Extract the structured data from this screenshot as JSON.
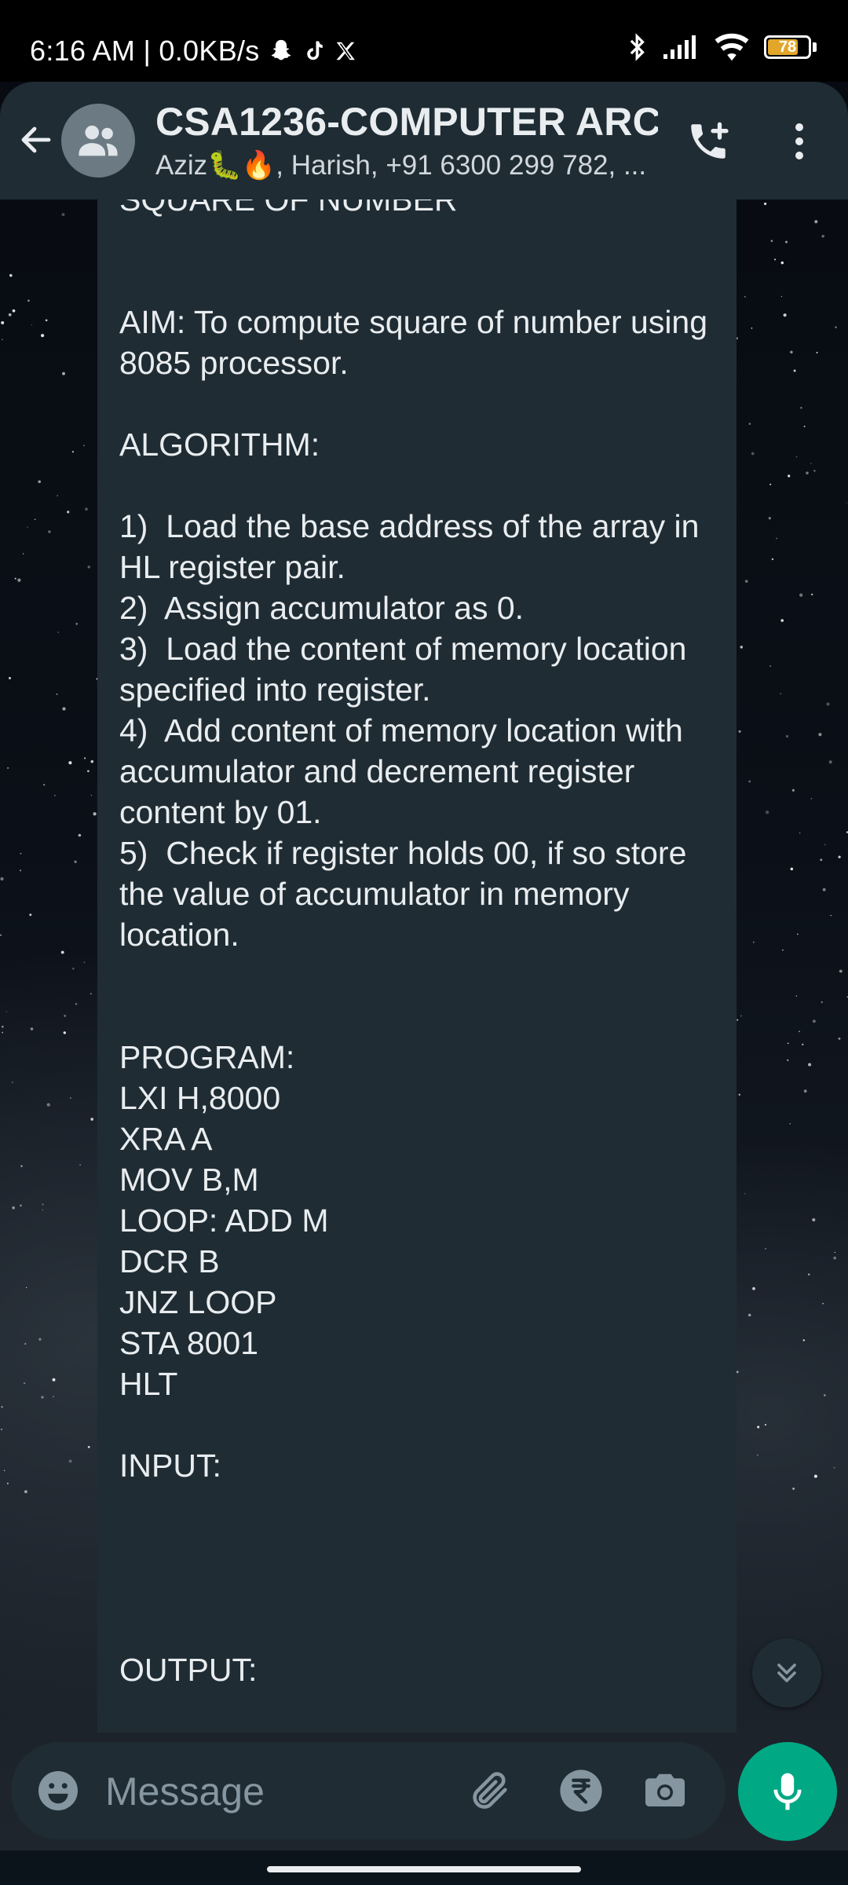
{
  "status_bar": {
    "time_and_speed": "6:16 AM | 0.0KB/s",
    "battery_level": "78",
    "icons": [
      "snapchat-icon",
      "tiktok-icon",
      "x-icon",
      "bluetooth-icon",
      "signal-icon",
      "wifi-icon",
      "battery-icon"
    ]
  },
  "header": {
    "title": "CSA1236-COMPUTER ARC...",
    "subtitle": "Aziz🐛🔥, Harish, +91 6300 299 782, ...",
    "icons": [
      "back-arrow-icon",
      "group-avatar-icon",
      "add-call-icon",
      "more-vert-icon"
    ]
  },
  "message": {
    "text": "SQUARE OF NUMBER\n\n\nAIM: To compute square of number using 8085 processor.\n\nALGORITHM:\n\n1)  Load the base address of the array in HL register pair.\n2)  Assign accumulator as 0.\n3)  Load the content of memory location specified into register.\n4)  Add content of memory location with accumulator and decrement register content by 01.\n5)  Check if register holds 00, if so store the value of accumulator in memory location.\n\n\nPROGRAM:\nLXI H,8000\nXRA A\nMOV B,M\nLOOP: ADD M\nDCR B\nJNZ LOOP\nSTA 8001\nHLT\n\nINPUT:\n\n\n\n\nOUTPUT:"
  },
  "composer": {
    "placeholder": "Message",
    "icons": [
      "emoji-icon",
      "attach-icon",
      "rupee-icon",
      "camera-icon",
      "mic-icon"
    ]
  },
  "colors": {
    "header_bg": "#1f2c34",
    "bubble_bg": "#1f2c34",
    "accent_green": "#00a884",
    "text_primary": "#e9edef",
    "text_muted": "#8696a0"
  }
}
